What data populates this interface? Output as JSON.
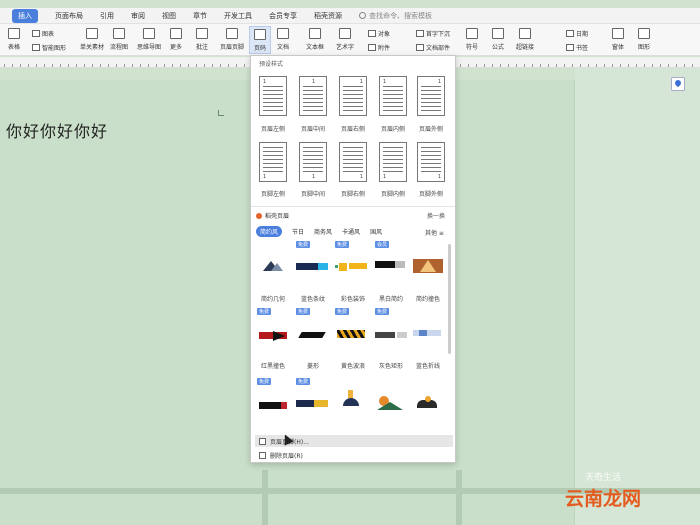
{
  "menu": {
    "items": [
      "插入",
      "页面布局",
      "引用",
      "审阅",
      "视图",
      "章节",
      "开发工具",
      "会员专享",
      "稻壳资源"
    ],
    "active_index": 0,
    "search_placeholder": "查找命令、搜索模板"
  },
  "ribbon": {
    "buttons": [
      "表格",
      "形状图形",
      "单关素材",
      "流程图",
      "思维导图",
      "更多",
      "批注",
      "页眉页脚",
      "页码",
      "文档",
      "文本框",
      "艺术字",
      "符号",
      "公式",
      "超链接",
      "书签",
      "窗体",
      "图形"
    ],
    "small": [
      "图表",
      "智能图形",
      "首字下沉",
      "对象",
      "附件",
      "文档部件",
      "日期"
    ]
  },
  "document": {
    "text": "你好你好你好"
  },
  "panel": {
    "title": "预设样式",
    "header_presets": [
      "页眉左侧",
      "页眉中间",
      "页眉右侧",
      "页眉内侧",
      "页眉外侧"
    ],
    "footer_presets": [
      "页脚左侧",
      "页脚中间",
      "页脚右侧",
      "页脚内侧",
      "页脚外侧"
    ],
    "premium_title": "稻壳页眉",
    "swap_label": "换一换",
    "categories": [
      "简约风",
      "节日",
      "商务风",
      "卡通风",
      "国风"
    ],
    "more_label": "其他 ≡",
    "design_badges": [
      "免费",
      "免费",
      "会员",
      "免费",
      "免费",
      "免费",
      "免费",
      "免费",
      "免费",
      "免费",
      "免费",
      "免费",
      "免费",
      "免费",
      "免费"
    ],
    "design_labels_row1": [
      "简约几何",
      "蓝色条纹",
      "彩色装饰",
      "黑白简约",
      "简约撞色"
    ],
    "design_labels_row2": [
      "红黑撞色",
      "菱形",
      "黄色波浪",
      "灰色矩形",
      "蓝色折线"
    ],
    "commands": [
      "页眉页脚(H)...",
      "删除页眉(R)"
    ]
  },
  "watermark": {
    "brand": "云南龙网",
    "sub": "天奇生活"
  }
}
